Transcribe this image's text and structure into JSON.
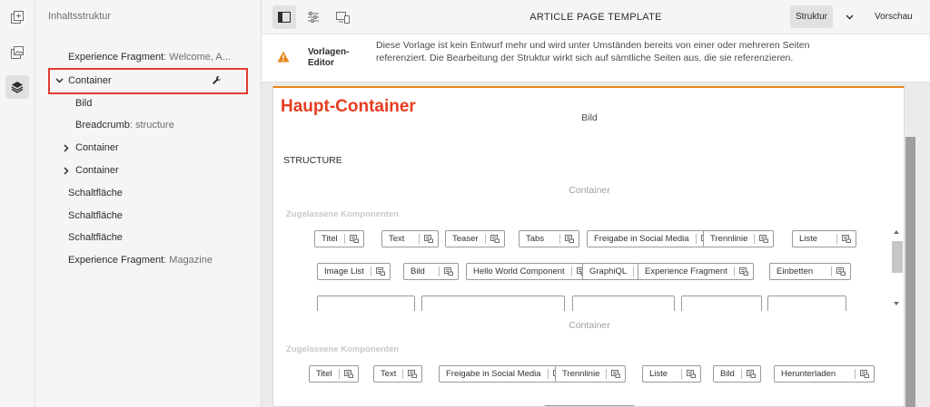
{
  "rail": {
    "icons": [
      "add-component-icon",
      "assets-icon",
      "layers-icon"
    ]
  },
  "panel": {
    "title": "Inhaltsstruktur",
    "tree": [
      {
        "label": "Experience Fragment",
        "sub": ": Welcome, A..."
      },
      {
        "label": "Container",
        "sub": ""
      },
      {
        "label": "Bild",
        "sub": ""
      },
      {
        "label": "Breadcrumb",
        "sub": ": structure"
      },
      {
        "label": "Container",
        "sub": ""
      },
      {
        "label": "Container",
        "sub": ""
      },
      {
        "label": "Schaltfläche",
        "sub": ""
      },
      {
        "label": "Schaltfläche",
        "sub": ""
      },
      {
        "label": "Schaltfläche",
        "sub": ""
      },
      {
        "label": "Experience Fragment",
        "sub": ": Magazine"
      }
    ]
  },
  "toolbar": {
    "title": "ARTICLE PAGE TEMPLATE",
    "mode_structure": "Struktur",
    "mode_preview": "Vorschau"
  },
  "alert": {
    "title": "Vorlagen-Editor",
    "text": "Diese Vorlage ist kein Entwurf mehr und wird unter Umständen bereits von einer oder mehreren Seiten referenziert. Die Bearbeitung der Struktur wirkt sich auf sämtliche Seiten aus, die sie referenzieren."
  },
  "canvas": {
    "overlay_label": "Haupt-Container",
    "bild_placeholder": "Bild",
    "structure_label": "STRUCTURE",
    "container1_label": "Container",
    "allowed1_label": "Zugelassene Komponenten",
    "chips1": [
      "Titel",
      "Text",
      "Teaser",
      "Tabs",
      "Freigabe in Social Media",
      "Trennlinie",
      "Liste",
      "Image List",
      "Bild",
      "Hello World Component",
      "GraphiQL",
      "Experience Fragment",
      "Einbetten"
    ],
    "container2_label": "Container",
    "allowed2_label": "Zugelassene Komponenten",
    "chips2": [
      "Titel",
      "Text",
      "Freigabe in Social Media",
      "Trennlinie",
      "Liste",
      "Bild",
      "Herunterladen"
    ]
  },
  "colors": {
    "highlight_red": "#e03c31",
    "overlay_label_red": "#e53d1f",
    "warning_orange": "#e68619"
  }
}
